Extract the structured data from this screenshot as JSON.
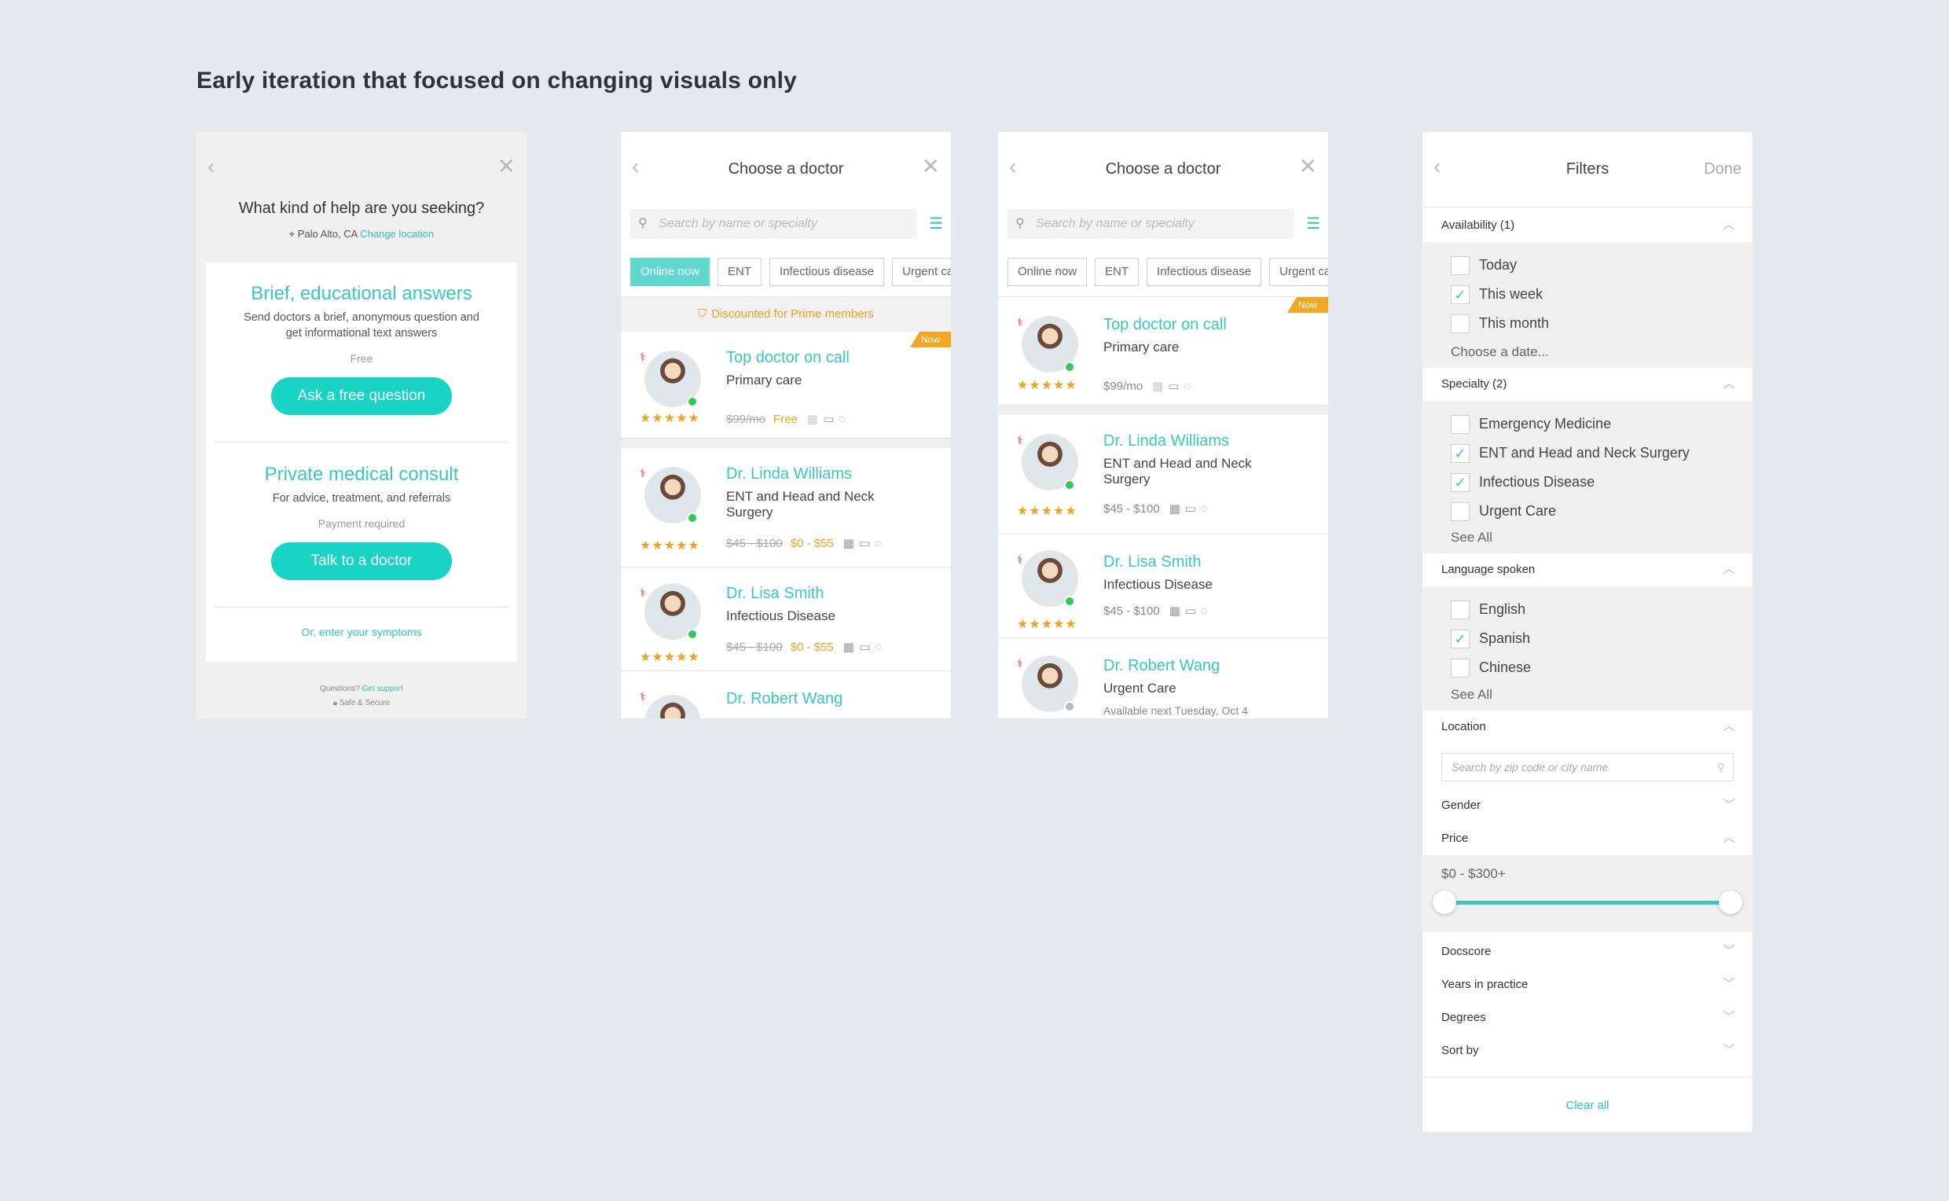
{
  "page_title": "Early iteration that focused on changing visuals only",
  "screen1": {
    "question": "What kind of help are you seeking?",
    "location": "Palo Alto, CA",
    "change_location": "Change location",
    "option1": {
      "title": "Brief, educational answers",
      "desc": "Send doctors a brief, anonymous question and get informational text answers",
      "price": "Free",
      "button": "Ask a free question"
    },
    "option2": {
      "title": "Private medical consult",
      "desc": "For advice, treatment, and referrals",
      "price": "Payment required",
      "button": "Talk to a doctor"
    },
    "symptoms_link": "Or, enter your symptoms",
    "questions": "Questions?",
    "get_support": "Get support",
    "safe": "Safe & Secure"
  },
  "screen2": {
    "title": "Choose a doctor",
    "search_placeholder": "Search by name or specialty",
    "chips": [
      "Online now",
      "ENT",
      "Infectious disease",
      "Urgent care"
    ],
    "banner": "Discounted for Prime members",
    "badge": "Now",
    "doctors": [
      {
        "name": "Top doctor on call",
        "specialty": "Primary care",
        "old_price": "$99/mo",
        "deal": "Free"
      },
      {
        "name": "Dr. Linda Williams",
        "specialty": "ENT and Head and Neck Surgery",
        "old_price": "$45 - $100",
        "deal": "$0 - $55"
      },
      {
        "name": "Dr. Lisa Smith",
        "specialty": "Infectious Disease",
        "old_price": "$45 - $100",
        "deal": "$0 - $55"
      },
      {
        "name": "Dr. Robert Wang"
      }
    ]
  },
  "screen3": {
    "title": "Choose a doctor",
    "search_placeholder": "Search by name or specialty",
    "chips": [
      "Online now",
      "ENT",
      "Infectious disease",
      "Urgent care"
    ],
    "badge": "Now",
    "doctors": [
      {
        "name": "Top doctor on call",
        "specialty": "Primary care",
        "price": "$99/mo"
      },
      {
        "name": "Dr. Linda Williams",
        "specialty": "ENT and Head and Neck Surgery",
        "price": "$45 - $100"
      },
      {
        "name": "Dr. Lisa Smith",
        "specialty": "Infectious Disease",
        "price": "$45 - $100"
      },
      {
        "name": "Dr. Robert Wang",
        "specialty": "Urgent Care",
        "availability": "Available next Tuesday, Oct 4"
      }
    ]
  },
  "filters": {
    "title": "Filters",
    "done": "Done",
    "availability": {
      "label": "Availability (1)",
      "options": [
        "Today",
        "This week",
        "This month"
      ],
      "checked": [
        false,
        true,
        false
      ],
      "choose_date": "Choose a date..."
    },
    "specialty": {
      "label": "Specialty (2)",
      "options": [
        "Emergency Medicine",
        "ENT and Head and Neck Surgery",
        "Infectious Disease",
        "Urgent Care"
      ],
      "checked": [
        false,
        true,
        true,
        false
      ],
      "see_all": "See All"
    },
    "language": {
      "label": "Language spoken",
      "options": [
        "English",
        "Spanish",
        "Chinese"
      ],
      "checked": [
        false,
        true,
        false
      ],
      "see_all": "See All"
    },
    "location": {
      "label": "Location",
      "placeholder": "Search by zip code or city name"
    },
    "gender": "Gender",
    "price": {
      "label": "Price",
      "range": "$0 - $300+",
      "min_fraction": 0,
      "max_fraction": 1
    },
    "docscore": "Docscore",
    "years": "Years in practice",
    "degrees": "Degrees",
    "sort_by": "Sort by",
    "clear_all": "Clear all"
  },
  "colors": {
    "accent": "#35c9bf",
    "button": "#19d3c5",
    "star": "#f3a11e",
    "badge": "#f5a623",
    "online": "#34c759"
  },
  "ratings": {
    "stars": "★★★★★"
  }
}
